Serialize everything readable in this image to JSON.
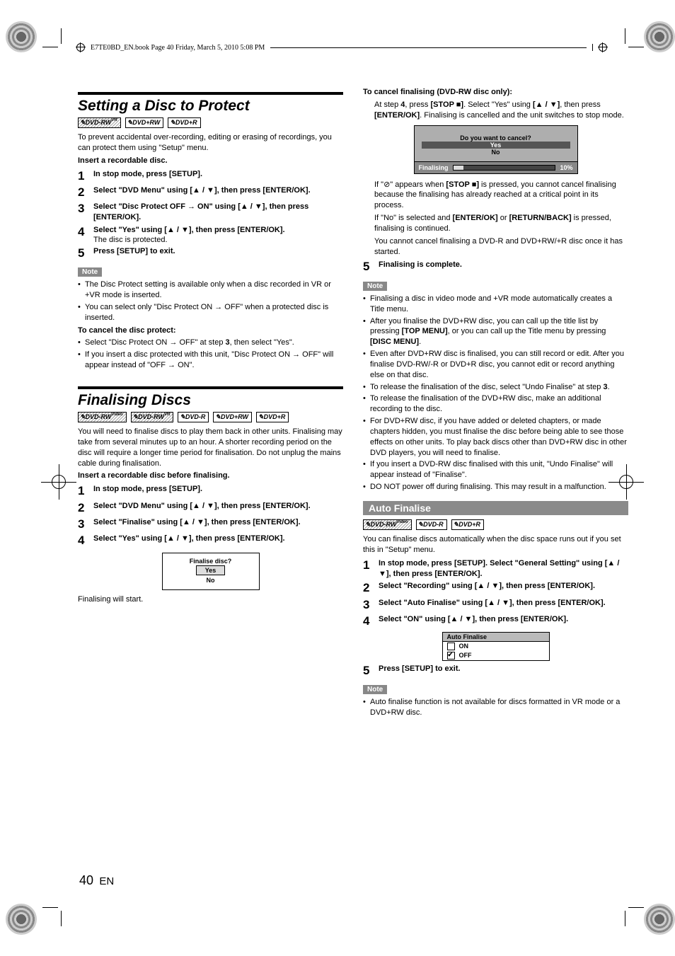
{
  "header": {
    "text": "E7TE0BD_EN.book  Page 40  Friday, March 5, 2010  5:08 PM"
  },
  "page": {
    "number": "40",
    "lang": "EN"
  },
  "glyphs": {
    "up": "▲",
    "down": "▼",
    "stop": "■",
    "arrow": "→",
    "prohibit": "⊘"
  },
  "labels": {
    "note": "Note"
  },
  "sec1": {
    "title": "Setting a Disc to Protect",
    "badges": [
      "DVD-RW",
      "DVD+RW",
      "DVD+R"
    ],
    "badge_sup": [
      "VR",
      "",
      ""
    ],
    "intro": "To prevent accidental over-recording, editing or erasing of recordings, you can protect them using \"Setup\" menu.",
    "insert": "Insert a recordable disc.",
    "steps": [
      {
        "n": "1",
        "head": "In stop mode, press [SETUP]."
      },
      {
        "n": "2",
        "head": "Select \"DVD Menu\" using [▲ / ▼], then press [ENTER/OK]."
      },
      {
        "n": "3",
        "head": "Select \"Disc Protect OFF → ON\" using [▲ / ▼], then press [ENTER/OK]."
      },
      {
        "n": "4",
        "head": "Select \"Yes\" using [▲ / ▼], then press [ENTER/OK].",
        "tail": "The disc is protected."
      },
      {
        "n": "5",
        "head": "Press [SETUP] to exit."
      }
    ],
    "notes": [
      "The Disc Protect setting is available only when a disc recorded in VR or +VR mode is inserted.",
      "You can select only \"Disc Protect ON → OFF\" when a protected disc is inserted."
    ],
    "cancel_head": "To cancel the disc protect:",
    "cancel_items": [
      "Select \"Disc Protect ON → OFF\" at step 3, then select \"Yes\".",
      "If you insert a disc protected with this unit, \"Disc Protect ON → OFF\" will appear instead of \"OFF → ON\"."
    ]
  },
  "sec2": {
    "title": "Finalising Discs",
    "badges": [
      "DVD-RW",
      "DVD-RW",
      "DVD-R",
      "DVD+RW",
      "DVD+R"
    ],
    "badge_sup": [
      "Video",
      "VR",
      "",
      "",
      ""
    ],
    "intro": "You will need to finalise discs to play them back in other units. Finalising may take from several minutes up to an hour. A shorter recording period on the disc will require a longer time period for finalisation. Do not unplug the mains cable during finalisation.",
    "insert": "Insert a recordable disc before finalising.",
    "steps": [
      {
        "n": "1",
        "head": "In stop mode, press [SETUP]."
      },
      {
        "n": "2",
        "head": "Select \"DVD Menu\" using [▲ / ▼], then press [ENTER/OK]."
      },
      {
        "n": "3",
        "head": "Select \"Finalise\" using [▲ / ▼], then press [ENTER/OK]."
      },
      {
        "n": "4",
        "head": "Select \"Yes\" using [▲ / ▼], then press [ENTER/OK]."
      }
    ],
    "dialog": {
      "title": "Finalise disc?",
      "yes": "Yes",
      "no": "No"
    },
    "start": "Finalising will start."
  },
  "right": {
    "cancel_head": "To cancel finalising (DVD-RW disc only):",
    "cancel_p1_a": "At step ",
    "cancel_p1_b": "4",
    "cancel_p1_c": ", press ",
    "cancel_p1_d": "[STOP ■]",
    "cancel_p1_e": ". Select \"Yes\" using ",
    "cancel_p1_f": "[▲ / ▼]",
    "cancel_p1_g": ", then press ",
    "cancel_p1_h": "[ENTER/OK]",
    "cancel_p1_i": ". Finalising is cancelled and the unit switches to stop mode.",
    "dialog2": {
      "q": "Do you want to cancel?",
      "yes": "Yes",
      "no": "No",
      "label": "Finalising",
      "pct": "10%"
    },
    "p_if_a": "If \"",
    "p_if_b": "\" appears when ",
    "p_if_c": "[STOP ■]",
    "p_if_d": " is pressed, you cannot cancel finalising because the finalising has already reached at a critical point in its process.",
    "p_ifno_a": "If \"No\" is selected and ",
    "p_ifno_b": "[ENTER/OK]",
    "p_ifno_c": " or ",
    "p_ifno_d": "[RETURN/BACK]",
    "p_ifno_e": " is pressed, finalising is continued.",
    "p_cannot": "You cannot cancel finalising a DVD-R and DVD+RW/+R disc once it has started.",
    "step5": {
      "n": "5",
      "head": "Finalising is complete."
    },
    "notes2": [
      "Finalising a disc in video mode and +VR mode automatically creates a Title menu.",
      "After you finalise the DVD+RW disc, you can call up the title list by pressing [TOP MENU], or you can call up the Title menu by pressing [DISC MENU].",
      "Even after DVD+RW disc is finalised, you can still record or edit. After you finalise DVD-RW/-R or DVD+R disc, you cannot edit or record anything else on that disc.",
      "To release the finalisation of the disc, select \"Undo Finalise\" at step 3.",
      "To release the finalisation of the DVD+RW disc, make an additional recording to the disc.",
      "For DVD+RW disc, if you have added or deleted chapters, or made chapters hidden, you must finalise the disc before being able to see those effects on other units. To play back discs other than DVD+RW disc in other DVD players, you will need to finalise.",
      "If you insert a DVD-RW disc finalised with this unit, \"Undo Finalise\" will appear instead of \"Finalise\".",
      "DO NOT power off during finalising. This may result in a malfunction."
    ],
    "auto": {
      "title": "Auto Finalise",
      "badges": [
        "DVD-RW",
        "DVD-R",
        "DVD+R"
      ],
      "badge_sup": [
        "Video",
        "",
        ""
      ],
      "intro": "You can finalise discs automatically when the disc space runs out if you set this in \"Setup\" menu.",
      "steps": [
        {
          "n": "1",
          "head": "In stop mode, press [SETUP]. Select \"General Setting\" using [▲ / ▼], then press [ENTER/OK]."
        },
        {
          "n": "2",
          "head": "Select \"Recording\" using [▲ / ▼], then press [ENTER/OK]."
        },
        {
          "n": "3",
          "head": "Select \"Auto Finalise\" using [▲ / ▼], then press [ENTER/OK]."
        },
        {
          "n": "4",
          "head": "Select \"ON\" using [▲ / ▼], then press [ENTER/OK]."
        }
      ],
      "menu": {
        "title": "Auto Finalise",
        "on": "ON",
        "off": "OFF"
      },
      "step5": {
        "n": "5",
        "head": "Press [SETUP] to exit."
      },
      "note": "Auto finalise function is not available for discs formatted in VR mode or a DVD+RW disc."
    }
  }
}
